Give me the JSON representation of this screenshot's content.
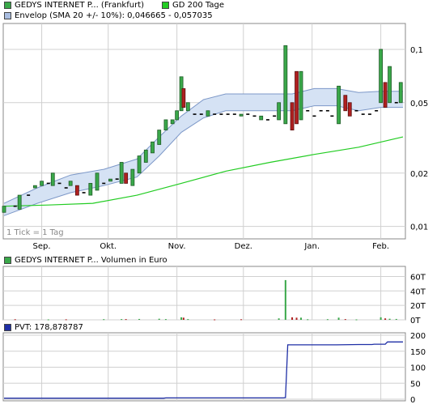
{
  "colors": {
    "up": "#3aa84a",
    "down": "#b02020",
    "sma": "#22cc22",
    "envelope_fill": "#d5e2f4",
    "envelope_line": "#7d98c8",
    "pvt": "#1f2fa6",
    "grid": "#d0d0d0"
  },
  "legend": {
    "price": "GEDYS INTERNET P... (Frankfurt)",
    "sma": "GD 200 Tage",
    "envelope": "Envelop (SMA 20 +/- 10%): 0,046665 - 0,057035",
    "volume": "GEDYS INTERNET P... Volumen in Euro",
    "pvt": "PVT: 178,878787"
  },
  "tick_note": "1 Tick = 1 Tag",
  "chart_data": [
    {
      "type": "candlestick",
      "scale": "log",
      "ylim": [
        0.0085,
        0.14
      ],
      "yticks": [
        {
          "value": 0.01,
          "label": "0,01"
        },
        {
          "value": 0.02,
          "label": "0,02"
        },
        {
          "value": 0.05,
          "label": "0,05"
        },
        {
          "value": 0.1,
          "label": "0,1"
        }
      ],
      "x_labels": [
        {
          "day": 17,
          "label": "Sep."
        },
        {
          "day": 47,
          "label": "Okt."
        },
        {
          "day": 78,
          "label": "Nov."
        },
        {
          "day": 108,
          "label": "Dez."
        },
        {
          "day": 139,
          "label": "Jan."
        },
        {
          "day": 170,
          "label": "Feb."
        }
      ],
      "x_range": [
        0,
        180
      ],
      "candles": [
        {
          "d": 0,
          "o": 0.012,
          "c": 0.013
        },
        {
          "d": 5,
          "o": 0.013,
          "c": 0.013
        },
        {
          "d": 7,
          "o": 0.0125,
          "c": 0.015
        },
        {
          "d": 11,
          "o": 0.015,
          "c": 0.015
        },
        {
          "d": 14,
          "o": 0.0165,
          "c": 0.017
        },
        {
          "d": 17,
          "o": 0.017,
          "c": 0.018
        },
        {
          "d": 20,
          "o": 0.0175,
          "c": 0.0175
        },
        {
          "d": 22,
          "o": 0.017,
          "c": 0.02
        },
        {
          "d": 25,
          "o": 0.0175,
          "c": 0.0175
        },
        {
          "d": 28,
          "o": 0.0165,
          "c": 0.0165
        },
        {
          "d": 30,
          "o": 0.017,
          "c": 0.018
        },
        {
          "d": 33,
          "o": 0.017,
          "c": 0.015
        },
        {
          "d": 36,
          "o": 0.0155,
          "c": 0.0155
        },
        {
          "d": 39,
          "o": 0.015,
          "c": 0.0175
        },
        {
          "d": 42,
          "o": 0.016,
          "c": 0.02
        },
        {
          "d": 45,
          "o": 0.0175,
          "c": 0.0175
        },
        {
          "d": 48,
          "o": 0.018,
          "c": 0.0185
        },
        {
          "d": 51,
          "o": 0.0185,
          "c": 0.0185
        },
        {
          "d": 53,
          "o": 0.0175,
          "c": 0.023
        },
        {
          "d": 55,
          "o": 0.02,
          "c": 0.0175
        },
        {
          "d": 58,
          "o": 0.017,
          "c": 0.021
        },
        {
          "d": 61,
          "o": 0.02,
          "c": 0.025
        },
        {
          "d": 64,
          "o": 0.023,
          "c": 0.027
        },
        {
          "d": 67,
          "o": 0.026,
          "c": 0.03
        },
        {
          "d": 70,
          "o": 0.029,
          "c": 0.035
        },
        {
          "d": 73,
          "o": 0.035,
          "c": 0.04
        },
        {
          "d": 76,
          "o": 0.038,
          "c": 0.04
        },
        {
          "d": 78,
          "o": 0.04,
          "c": 0.045
        },
        {
          "d": 80,
          "o": 0.045,
          "c": 0.07
        },
        {
          "d": 81,
          "o": 0.06,
          "c": 0.047
        },
        {
          "d": 83,
          "o": 0.045,
          "c": 0.05
        },
        {
          "d": 86,
          "o": 0.043,
          "c": 0.043
        },
        {
          "d": 89,
          "o": 0.043,
          "c": 0.043
        },
        {
          "d": 92,
          "o": 0.042,
          "c": 0.045
        },
        {
          "d": 95,
          "o": 0.043,
          "c": 0.043
        },
        {
          "d": 98,
          "o": 0.043,
          "c": 0.043
        },
        {
          "d": 101,
          "o": 0.043,
          "c": 0.043
        },
        {
          "d": 104,
          "o": 0.043,
          "c": 0.043
        },
        {
          "d": 107,
          "o": 0.042,
          "c": 0.043
        },
        {
          "d": 110,
          "o": 0.043,
          "c": 0.043
        },
        {
          "d": 113,
          "o": 0.042,
          "c": 0.042
        },
        {
          "d": 116,
          "o": 0.04,
          "c": 0.042
        },
        {
          "d": 119,
          "o": 0.04,
          "c": 0.04
        },
        {
          "d": 122,
          "o": 0.042,
          "c": 0.042
        },
        {
          "d": 124,
          "o": 0.04,
          "c": 0.05
        },
        {
          "d": 127,
          "o": 0.038,
          "c": 0.105
        },
        {
          "d": 130,
          "o": 0.05,
          "c": 0.035
        },
        {
          "d": 132,
          "o": 0.075,
          "c": 0.038
        },
        {
          "d": 134,
          "o": 0.04,
          "c": 0.075
        },
        {
          "d": 137,
          "o": 0.045,
          "c": 0.045
        },
        {
          "d": 140,
          "o": 0.042,
          "c": 0.042
        },
        {
          "d": 143,
          "o": 0.045,
          "c": 0.045
        },
        {
          "d": 146,
          "o": 0.045,
          "c": 0.045
        },
        {
          "d": 148,
          "o": 0.042,
          "c": 0.042
        },
        {
          "d": 151,
          "o": 0.038,
          "c": 0.062
        },
        {
          "d": 154,
          "o": 0.055,
          "c": 0.045
        },
        {
          "d": 156,
          "o": 0.05,
          "c": 0.042
        },
        {
          "d": 159,
          "o": 0.045,
          "c": 0.045
        },
        {
          "d": 162,
          "o": 0.043,
          "c": 0.043
        },
        {
          "d": 165,
          "o": 0.043,
          "c": 0.043
        },
        {
          "d": 168,
          "o": 0.045,
          "c": 0.045
        },
        {
          "d": 170,
          "o": 0.05,
          "c": 0.1
        },
        {
          "d": 172,
          "o": 0.065,
          "c": 0.047
        },
        {
          "d": 174,
          "o": 0.05,
          "c": 0.08
        },
        {
          "d": 177,
          "o": 0.05,
          "c": 0.05
        },
        {
          "d": 179,
          "o": 0.05,
          "c": 0.065
        }
      ],
      "envelope": {
        "x": [
          0,
          15,
          30,
          45,
          60,
          70,
          80,
          90,
          100,
          110,
          120,
          130,
          140,
          150,
          160,
          170,
          180
        ],
        "upper": [
          0.0135,
          0.0165,
          0.0195,
          0.021,
          0.024,
          0.032,
          0.042,
          0.052,
          0.056,
          0.056,
          0.056,
          0.056,
          0.06,
          0.06,
          0.057,
          0.058,
          0.058
        ],
        "lower": [
          0.0115,
          0.0135,
          0.0155,
          0.017,
          0.019,
          0.025,
          0.034,
          0.041,
          0.045,
          0.045,
          0.045,
          0.045,
          0.048,
          0.048,
          0.045,
          0.047,
          0.047
        ]
      },
      "sma": {
        "x": [
          0,
          20,
          40,
          60,
          80,
          100,
          120,
          140,
          160,
          180
        ],
        "y": [
          0.013,
          0.0132,
          0.0135,
          0.015,
          0.0175,
          0.0205,
          0.023,
          0.0255,
          0.028,
          0.032
        ]
      }
    },
    {
      "type": "bar",
      "yticks": [
        {
          "value": 0,
          "label": "0T"
        },
        {
          "value": 20,
          "label": "20T"
        },
        {
          "value": 40,
          "label": "40T"
        },
        {
          "value": 60,
          "label": "60T"
        }
      ],
      "ylim": [
        0,
        65
      ],
      "bars": [
        {
          "d": 5,
          "v": 0.8,
          "up": false
        },
        {
          "d": 20,
          "v": 0.6,
          "up": true
        },
        {
          "d": 28,
          "v": 0.7,
          "up": false
        },
        {
          "d": 45,
          "v": 0.9,
          "up": true
        },
        {
          "d": 53,
          "v": 1.0,
          "up": true
        },
        {
          "d": 55,
          "v": 1.0,
          "up": false
        },
        {
          "d": 61,
          "v": 1.2,
          "up": true
        },
        {
          "d": 70,
          "v": 1.5,
          "up": true
        },
        {
          "d": 73,
          "v": 1.0,
          "up": true
        },
        {
          "d": 80,
          "v": 3.5,
          "up": true
        },
        {
          "d": 81,
          "v": 3.0,
          "up": false
        },
        {
          "d": 83,
          "v": 1.0,
          "up": true
        },
        {
          "d": 95,
          "v": 0.6,
          "up": false
        },
        {
          "d": 107,
          "v": 0.8,
          "up": false
        },
        {
          "d": 124,
          "v": 2.0,
          "up": true
        },
        {
          "d": 127,
          "v": 55,
          "up": true
        },
        {
          "d": 130,
          "v": 3.5,
          "up": false
        },
        {
          "d": 132,
          "v": 3.0,
          "up": false
        },
        {
          "d": 134,
          "v": 3.0,
          "up": true
        },
        {
          "d": 137,
          "v": 0.8,
          "up": true
        },
        {
          "d": 146,
          "v": 0.9,
          "up": true
        },
        {
          "d": 151,
          "v": 3.0,
          "up": true
        },
        {
          "d": 154,
          "v": 1.0,
          "up": false
        },
        {
          "d": 159,
          "v": 0.6,
          "up": true
        },
        {
          "d": 170,
          "v": 3.5,
          "up": true
        },
        {
          "d": 172,
          "v": 2.0,
          "up": false
        },
        {
          "d": 174,
          "v": 1.5,
          "up": true
        },
        {
          "d": 177,
          "v": 1.2,
          "up": true
        }
      ]
    },
    {
      "type": "line",
      "yticks": [
        {
          "value": 0,
          "label": "0"
        },
        {
          "value": 50,
          "label": "50"
        },
        {
          "value": 100,
          "label": "100"
        },
        {
          "value": 150,
          "label": "150"
        },
        {
          "value": 200,
          "label": "200"
        }
      ],
      "ylim": [
        0,
        200
      ],
      "x": [
        0,
        72,
        73,
        126,
        127,
        128,
        150,
        160,
        166,
        167,
        172,
        173,
        180
      ],
      "y": [
        3,
        3,
        4,
        4,
        5,
        170,
        170,
        171,
        171,
        172,
        172,
        178.9,
        178.9
      ]
    }
  ]
}
